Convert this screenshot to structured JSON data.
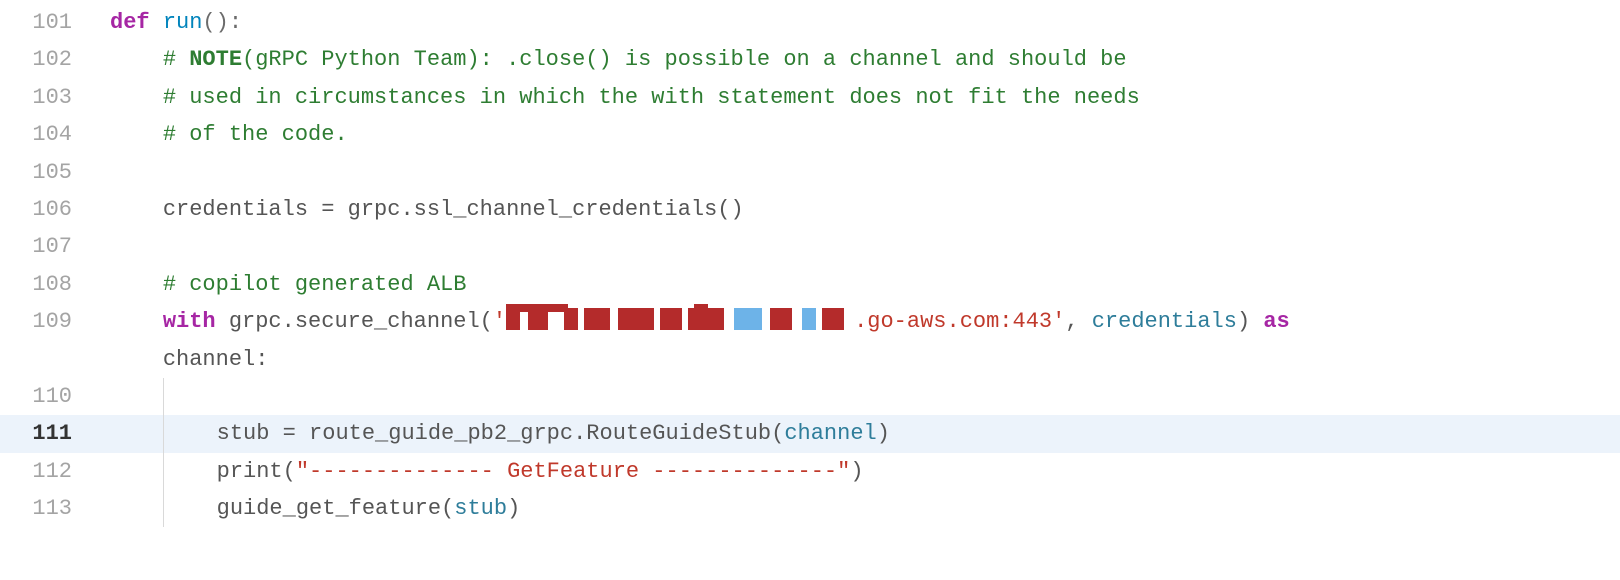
{
  "lines": [
    {
      "num": 101,
      "changed": false,
      "current": false,
      "indent": 0,
      "tokens": [
        {
          "cls": "tok-keyword",
          "t": "def"
        },
        {
          "cls": "",
          "t": " "
        },
        {
          "cls": "tok-def",
          "t": "run"
        },
        {
          "cls": "tok-paren",
          "t": "():"
        }
      ]
    },
    {
      "num": 102,
      "changed": false,
      "current": false,
      "indent": 1,
      "tokens": [
        {
          "cls": "tok-comment",
          "t": "# "
        },
        {
          "cls": "tok-comment-strong",
          "t": "NOTE"
        },
        {
          "cls": "tok-comment",
          "t": "(gRPC Python Team): .close() is possible on a channel and should be"
        }
      ]
    },
    {
      "num": 103,
      "changed": false,
      "current": false,
      "indent": 1,
      "tokens": [
        {
          "cls": "tok-comment",
          "t": "# used in circumstances in which the with statement does not fit the needs"
        }
      ]
    },
    {
      "num": 104,
      "changed": false,
      "current": false,
      "indent": 1,
      "tokens": [
        {
          "cls": "tok-comment",
          "t": "# of the code."
        }
      ]
    },
    {
      "num": 105,
      "changed": true,
      "current": false,
      "indent": 0,
      "tokens": []
    },
    {
      "num": 106,
      "changed": true,
      "current": false,
      "indent": 1,
      "tokens": [
        {
          "cls": "tok-ident",
          "t": "credentials = grpc.ssl_channel_credentials()"
        }
      ]
    },
    {
      "num": 107,
      "changed": true,
      "current": false,
      "indent": 0,
      "tokens": []
    },
    {
      "num": 108,
      "changed": true,
      "current": false,
      "indent": 1,
      "tokens": [
        {
          "cls": "tok-comment",
          "t": "# copilot generated ALB"
        }
      ]
    },
    {
      "num": 109,
      "changed": true,
      "current": false,
      "indent": 1,
      "tokens": [
        {
          "cls": "tok-keyword",
          "t": "with"
        },
        {
          "cls": "",
          "t": " "
        },
        {
          "cls": "tok-ident",
          "t": "grpc.secure_channel("
        },
        {
          "cls": "tok-string",
          "t": "'"
        },
        {
          "cls": "pixelated",
          "t": ""
        },
        {
          "cls": "tok-string",
          "t": ".go-aws.com:443'"
        },
        {
          "cls": "tok-ident",
          "t": ", "
        },
        {
          "cls": "tok-param",
          "t": "credentials"
        },
        {
          "cls": "tok-ident",
          "t": ") "
        },
        {
          "cls": "tok-keyword",
          "t": "as"
        }
      ]
    },
    {
      "num": "",
      "changed": true,
      "current": false,
      "indent": 1,
      "continuation": true,
      "tokens": [
        {
          "cls": "tok-ident",
          "t": "channel:"
        }
      ]
    },
    {
      "num": 110,
      "changed": true,
      "current": false,
      "indent": 0,
      "guide": true,
      "tokens": []
    },
    {
      "num": 111,
      "changed": false,
      "current": true,
      "indent": 2,
      "guide": true,
      "tokens": [
        {
          "cls": "tok-ident",
          "t": "stub = route_guide_pb2_grpc.RouteGuideStub("
        },
        {
          "cls": "tok-param",
          "t": "channel"
        },
        {
          "cls": "tok-ident",
          "t": ")"
        }
      ]
    },
    {
      "num": 112,
      "changed": false,
      "current": false,
      "indent": 2,
      "guide": true,
      "tokens": [
        {
          "cls": "tok-ident",
          "t": "print("
        },
        {
          "cls": "tok-string",
          "t": "\"-------------- GetFeature --------------\""
        },
        {
          "cls": "tok-ident",
          "t": ")"
        }
      ]
    },
    {
      "num": 113,
      "changed": false,
      "current": false,
      "indent": 2,
      "guide": true,
      "tokens": [
        {
          "cls": "tok-ident",
          "t": "guide_get_feature("
        },
        {
          "cls": "tok-param",
          "t": "stub"
        },
        {
          "cls": "tok-ident",
          "t": ")"
        }
      ]
    }
  ]
}
